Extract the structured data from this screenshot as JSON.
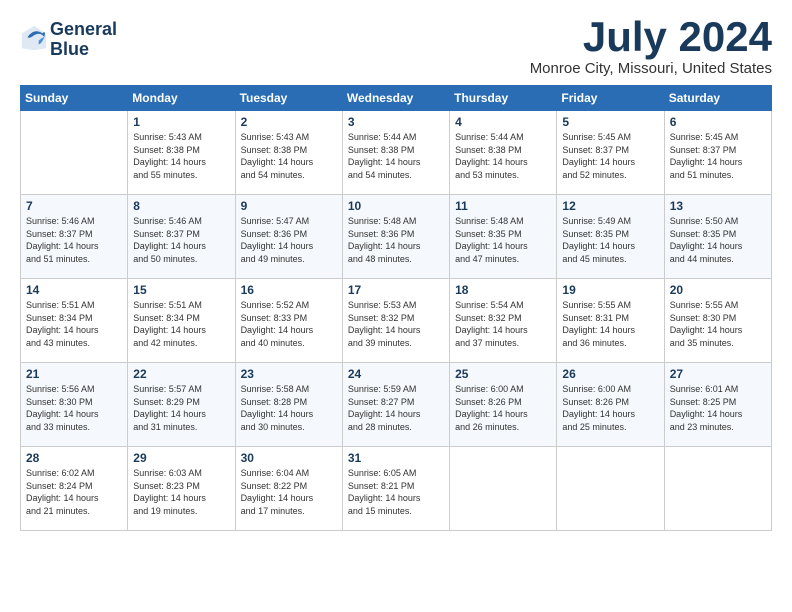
{
  "logo": {
    "line1": "General",
    "line2": "Blue"
  },
  "title": "July 2024",
  "location": "Monroe City, Missouri, United States",
  "weekdays": [
    "Sunday",
    "Monday",
    "Tuesday",
    "Wednesday",
    "Thursday",
    "Friday",
    "Saturday"
  ],
  "weeks": [
    [
      {
        "day": "",
        "content": ""
      },
      {
        "day": "1",
        "content": "Sunrise: 5:43 AM\nSunset: 8:38 PM\nDaylight: 14 hours\nand 55 minutes."
      },
      {
        "day": "2",
        "content": "Sunrise: 5:43 AM\nSunset: 8:38 PM\nDaylight: 14 hours\nand 54 minutes."
      },
      {
        "day": "3",
        "content": "Sunrise: 5:44 AM\nSunset: 8:38 PM\nDaylight: 14 hours\nand 54 minutes."
      },
      {
        "day": "4",
        "content": "Sunrise: 5:44 AM\nSunset: 8:38 PM\nDaylight: 14 hours\nand 53 minutes."
      },
      {
        "day": "5",
        "content": "Sunrise: 5:45 AM\nSunset: 8:37 PM\nDaylight: 14 hours\nand 52 minutes."
      },
      {
        "day": "6",
        "content": "Sunrise: 5:45 AM\nSunset: 8:37 PM\nDaylight: 14 hours\nand 51 minutes."
      }
    ],
    [
      {
        "day": "7",
        "content": "Sunrise: 5:46 AM\nSunset: 8:37 PM\nDaylight: 14 hours\nand 51 minutes."
      },
      {
        "day": "8",
        "content": "Sunrise: 5:46 AM\nSunset: 8:37 PM\nDaylight: 14 hours\nand 50 minutes."
      },
      {
        "day": "9",
        "content": "Sunrise: 5:47 AM\nSunset: 8:36 PM\nDaylight: 14 hours\nand 49 minutes."
      },
      {
        "day": "10",
        "content": "Sunrise: 5:48 AM\nSunset: 8:36 PM\nDaylight: 14 hours\nand 48 minutes."
      },
      {
        "day": "11",
        "content": "Sunrise: 5:48 AM\nSunset: 8:35 PM\nDaylight: 14 hours\nand 47 minutes."
      },
      {
        "day": "12",
        "content": "Sunrise: 5:49 AM\nSunset: 8:35 PM\nDaylight: 14 hours\nand 45 minutes."
      },
      {
        "day": "13",
        "content": "Sunrise: 5:50 AM\nSunset: 8:35 PM\nDaylight: 14 hours\nand 44 minutes."
      }
    ],
    [
      {
        "day": "14",
        "content": "Sunrise: 5:51 AM\nSunset: 8:34 PM\nDaylight: 14 hours\nand 43 minutes."
      },
      {
        "day": "15",
        "content": "Sunrise: 5:51 AM\nSunset: 8:34 PM\nDaylight: 14 hours\nand 42 minutes."
      },
      {
        "day": "16",
        "content": "Sunrise: 5:52 AM\nSunset: 8:33 PM\nDaylight: 14 hours\nand 40 minutes."
      },
      {
        "day": "17",
        "content": "Sunrise: 5:53 AM\nSunset: 8:32 PM\nDaylight: 14 hours\nand 39 minutes."
      },
      {
        "day": "18",
        "content": "Sunrise: 5:54 AM\nSunset: 8:32 PM\nDaylight: 14 hours\nand 37 minutes."
      },
      {
        "day": "19",
        "content": "Sunrise: 5:55 AM\nSunset: 8:31 PM\nDaylight: 14 hours\nand 36 minutes."
      },
      {
        "day": "20",
        "content": "Sunrise: 5:55 AM\nSunset: 8:30 PM\nDaylight: 14 hours\nand 35 minutes."
      }
    ],
    [
      {
        "day": "21",
        "content": "Sunrise: 5:56 AM\nSunset: 8:30 PM\nDaylight: 14 hours\nand 33 minutes."
      },
      {
        "day": "22",
        "content": "Sunrise: 5:57 AM\nSunset: 8:29 PM\nDaylight: 14 hours\nand 31 minutes."
      },
      {
        "day": "23",
        "content": "Sunrise: 5:58 AM\nSunset: 8:28 PM\nDaylight: 14 hours\nand 30 minutes."
      },
      {
        "day": "24",
        "content": "Sunrise: 5:59 AM\nSunset: 8:27 PM\nDaylight: 14 hours\nand 28 minutes."
      },
      {
        "day": "25",
        "content": "Sunrise: 6:00 AM\nSunset: 8:26 PM\nDaylight: 14 hours\nand 26 minutes."
      },
      {
        "day": "26",
        "content": "Sunrise: 6:00 AM\nSunset: 8:26 PM\nDaylight: 14 hours\nand 25 minutes."
      },
      {
        "day": "27",
        "content": "Sunrise: 6:01 AM\nSunset: 8:25 PM\nDaylight: 14 hours\nand 23 minutes."
      }
    ],
    [
      {
        "day": "28",
        "content": "Sunrise: 6:02 AM\nSunset: 8:24 PM\nDaylight: 14 hours\nand 21 minutes."
      },
      {
        "day": "29",
        "content": "Sunrise: 6:03 AM\nSunset: 8:23 PM\nDaylight: 14 hours\nand 19 minutes."
      },
      {
        "day": "30",
        "content": "Sunrise: 6:04 AM\nSunset: 8:22 PM\nDaylight: 14 hours\nand 17 minutes."
      },
      {
        "day": "31",
        "content": "Sunrise: 6:05 AM\nSunset: 8:21 PM\nDaylight: 14 hours\nand 15 minutes."
      },
      {
        "day": "",
        "content": ""
      },
      {
        "day": "",
        "content": ""
      },
      {
        "day": "",
        "content": ""
      }
    ]
  ]
}
